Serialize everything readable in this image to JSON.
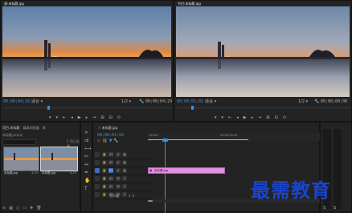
{
  "source_monitor": {
    "tab_label": "源:未标题.jpg",
    "timecode_current": "00;00;04;16",
    "fit_label": "适合",
    "fraction": "1/2",
    "timecode_duration": "00;00;04;29"
  },
  "program_monitor": {
    "tab_label": "节目:未标题.jpg",
    "timecode_current": "00;00;01;02",
    "fit_label": "适合",
    "fraction": "1/2",
    "timecode_duration": "00;00;00;00"
  },
  "project_panel": {
    "tabs": [
      "项目:未标题",
      "媒体浏览器",
      "库"
    ],
    "path": "未标题.prproj",
    "count_label": "1 项已选择",
    "items": [
      {
        "name": "未标题.jpg",
        "duration": "4:29"
      },
      {
        "name": "未标题.jpg",
        "duration": "4:29"
      }
    ]
  },
  "timeline": {
    "tab_label": "未标题.jpg",
    "timecode": "00;00;01;02",
    "ruler_marks": [
      ":00;00",
      "00;00;05;00"
    ],
    "tracks": [
      {
        "label": "V3"
      },
      {
        "label": "V2"
      },
      {
        "label": "V1"
      },
      {
        "label": "A1"
      },
      {
        "label": "A2"
      },
      {
        "label": "A3"
      }
    ],
    "master_label": "主声道",
    "master_value": "0.0",
    "clip_label": "未标题.jpg"
  },
  "watermark": "最需教育"
}
